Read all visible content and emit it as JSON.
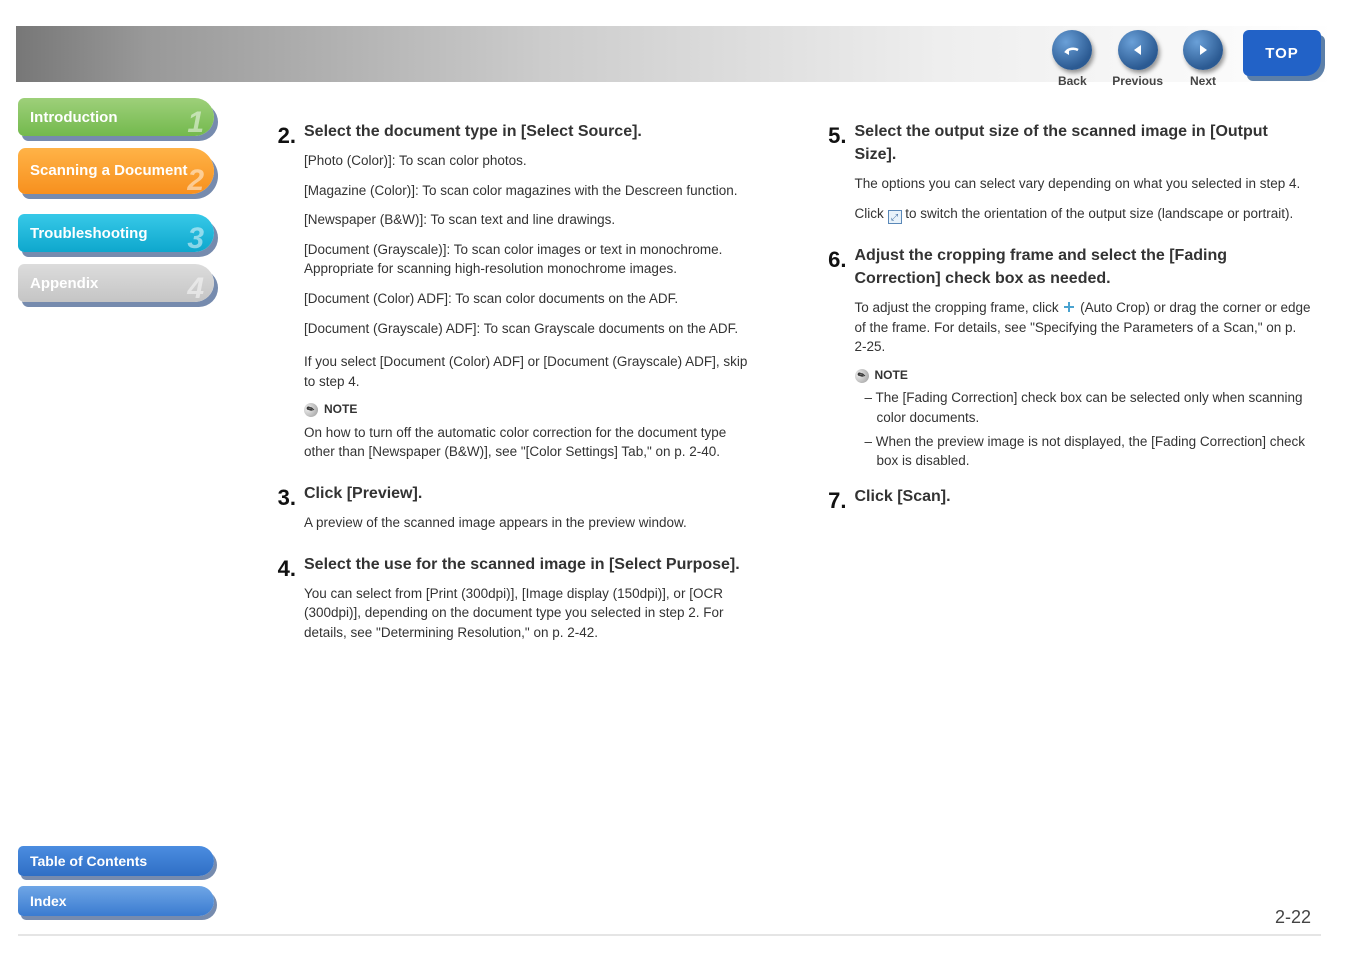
{
  "top_nav": {
    "back": "Back",
    "previous": "Previous",
    "next": "Next",
    "top": "TOP"
  },
  "sidebar": {
    "items": [
      {
        "label": "Introduction",
        "num": "1"
      },
      {
        "label": "Scanning a Document",
        "num": "2"
      },
      {
        "label": "Troubleshooting",
        "num": "3"
      },
      {
        "label": "Appendix",
        "num": "4"
      }
    ]
  },
  "bottom_links": {
    "toc": "Table of Contents",
    "index": "Index"
  },
  "page_number": "2-22",
  "left_col": {
    "step2": {
      "num": "2.",
      "title": "Select the document type in [Select Source].",
      "p1": "[Photo (Color)]: To scan color photos.",
      "p2": "[Magazine (Color)]: To scan color magazines with the Descreen function.",
      "p3": "[Newspaper (B&W)]: To scan text and line drawings.",
      "p4": "[Document (Grayscale)]: To scan color images or text in monochrome. Appropriate for scanning high-resolution monochrome images.",
      "p5": "[Document (Color) ADF]: To scan color documents on the ADF.",
      "p6": "[Document (Grayscale) ADF]: To scan Grayscale documents on the ADF.",
      "p7": "If you select [Document (Color) ADF] or [Document (Grayscale) ADF], skip to step 4.",
      "note_label": "NOTE",
      "note_text": "On how to turn off the automatic color correction for the document type other than [Newspaper (B&W)], see \"[Color Settings] Tab,\" on p. 2-40."
    },
    "step3": {
      "num": "3.",
      "title": "Click [Preview].",
      "p1": "A preview of the scanned image appears in the preview window."
    },
    "step4": {
      "num": "4.",
      "title": "Select the use for the scanned image in [Select Purpose].",
      "p1": "You can select from [Print (300dpi)], [Image display (150dpi)], or [OCR (300dpi)], depending on the document type you selected in step 2. For details, see \"Determining Resolution,\" on p. 2-42."
    }
  },
  "right_col": {
    "step5": {
      "num": "5.",
      "title": "Select the output size of the scanned image in [Output Size].",
      "p1": "The options you can select vary depending on what you selected in step 4.",
      "p2a": "Click ",
      "p2b": " to switch the orientation of the output size (landscape or portrait)."
    },
    "step6": {
      "num": "6.",
      "title": "Adjust the cropping frame and select the [Fading Correction] check box as needed.",
      "p1a": "To adjust the cropping frame, click ",
      "p1b": " (Auto Crop) or drag the corner or edge of the frame. For details, see \"Specifying the Parameters of a Scan,\" on p. 2-25.",
      "note_label": "NOTE",
      "bullet1": "– The [Fading Correction] check box can be selected only when scanning color documents.",
      "bullet2": "– When the preview image is not displayed, the [Fading Correction] check box is disabled."
    },
    "step7": {
      "num": "7.",
      "title": "Click [Scan]."
    }
  }
}
